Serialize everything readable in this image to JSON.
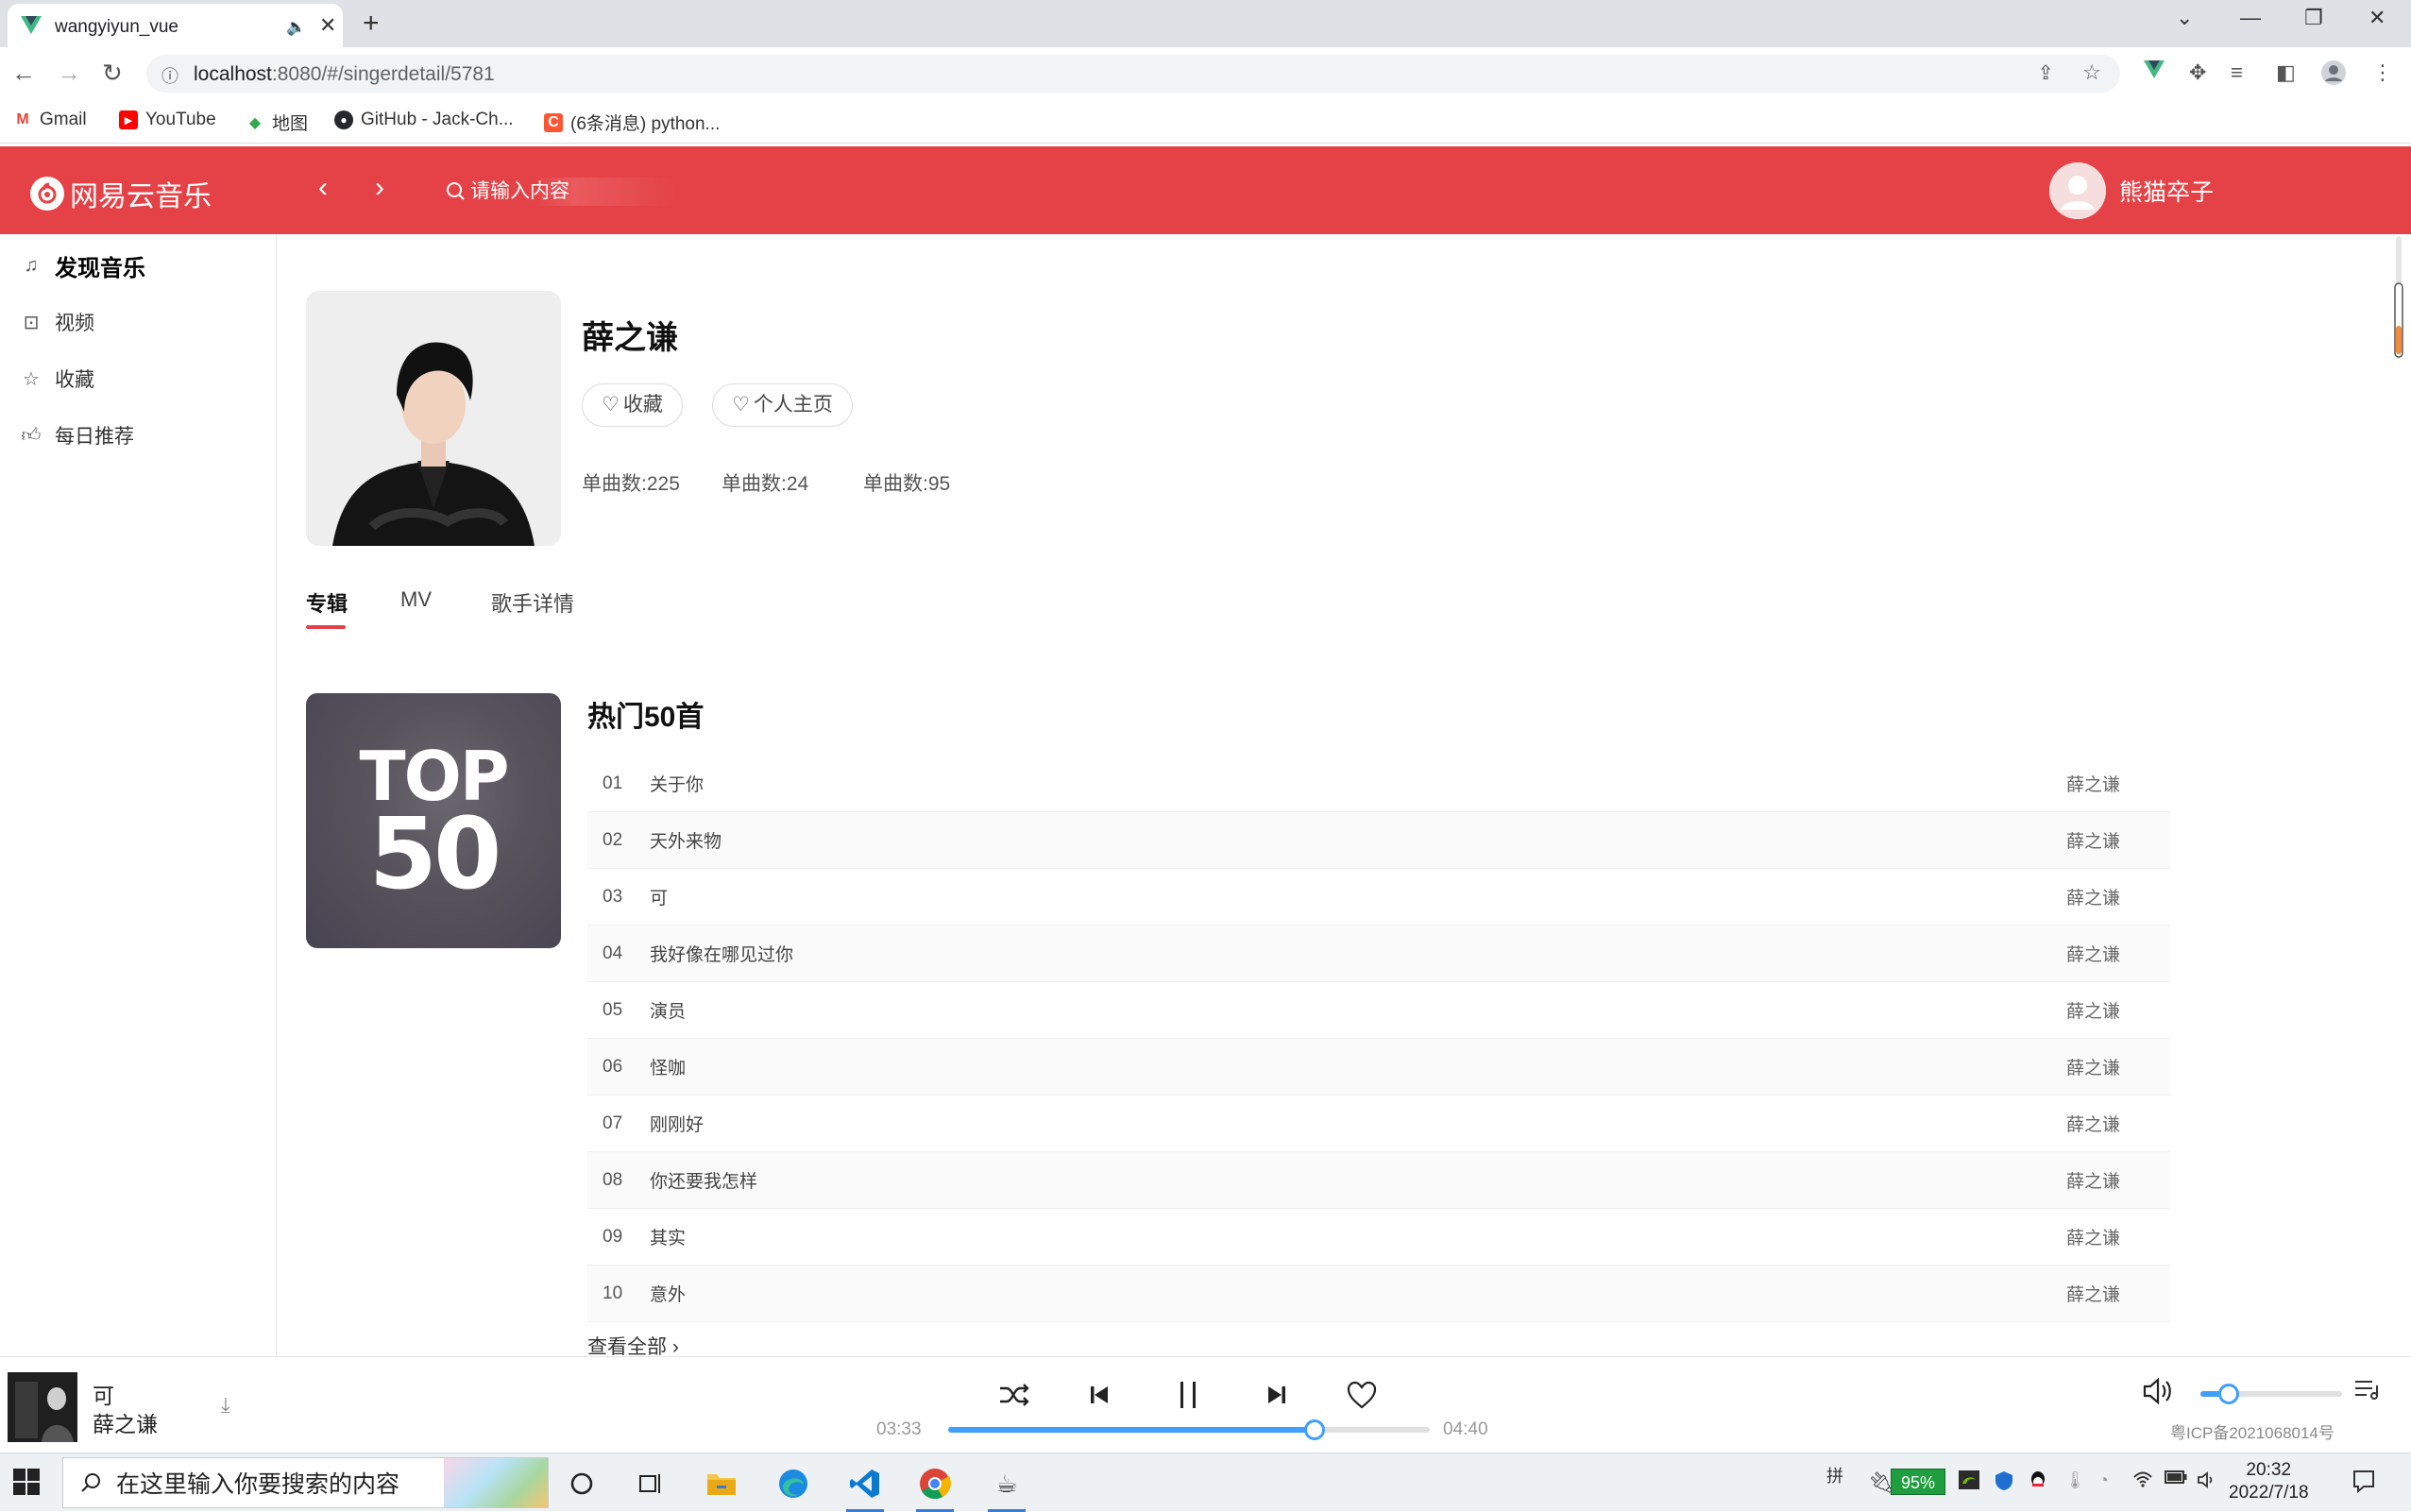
{
  "browser": {
    "tab_title": "wangyiyun_vue",
    "url_host": "localhost",
    "url_path": ":8080/#/singerdetail/5781",
    "bookmarks": [
      {
        "label": "Gmail",
        "icon": "gmail-icon",
        "color": "#ea4335"
      },
      {
        "label": "YouTube",
        "icon": "youtube-icon",
        "color": "#ff0000"
      },
      {
        "label": "地图",
        "icon": "maps-icon",
        "color": "#34a853"
      },
      {
        "label": "GitHub - Jack-Ch...",
        "icon": "github-icon",
        "color": "#24292e"
      },
      {
        "label": "(6条消息) python...",
        "icon": "csdn-icon",
        "color": "#fc5531"
      }
    ]
  },
  "app": {
    "logo_text": "网易云音乐",
    "search_placeholder": "请输入内容",
    "user_name": "熊猫卒子",
    "accent_color": "#e44246"
  },
  "sidebar": {
    "items": [
      {
        "label": "发现音乐",
        "icon": "music-note-icon"
      },
      {
        "label": "视频",
        "icon": "video-icon"
      },
      {
        "label": "收藏",
        "icon": "star-icon"
      },
      {
        "label": "每日推荐",
        "icon": "thumbs-up-icon"
      }
    ]
  },
  "singer": {
    "name": "薛之谦",
    "collect_label": "收藏",
    "homepage_label": "个人主页",
    "stats": [
      "单曲数:225",
      "单曲数:24",
      "单曲数:95"
    ]
  },
  "tabs": [
    "专辑",
    "MV",
    "歌手详情"
  ],
  "top50": {
    "title": "热门50首",
    "cover_line1": "TOP",
    "cover_line2": "50",
    "songs": [
      {
        "no": "01",
        "name": "关于你",
        "artist": "薛之谦"
      },
      {
        "no": "02",
        "name": "天外来物",
        "artist": "薛之谦"
      },
      {
        "no": "03",
        "name": "可",
        "artist": "薛之谦"
      },
      {
        "no": "04",
        "name": "我好像在哪见过你",
        "artist": "薛之谦"
      },
      {
        "no": "05",
        "name": "演员",
        "artist": "薛之谦"
      },
      {
        "no": "06",
        "name": "怪咖",
        "artist": "薛之谦"
      },
      {
        "no": "07",
        "name": "刚刚好",
        "artist": "薛之谦"
      },
      {
        "no": "08",
        "name": "你还要我怎样",
        "artist": "薛之谦"
      },
      {
        "no": "09",
        "name": "其实",
        "artist": "薛之谦"
      },
      {
        "no": "10",
        "name": "意外",
        "artist": "薛之谦"
      }
    ],
    "view_all": "查看全部"
  },
  "player": {
    "title": "可",
    "artist": "薛之谦",
    "current_time": "03:33",
    "total_time": "04:40",
    "progress": 0.76,
    "volume": 0.2,
    "icp": "粤ICP备2021068014号"
  },
  "taskbar": {
    "search_placeholder": "在这里输入你要搜索的内容",
    "ime": "拼",
    "battery": "95%",
    "time": "20:32",
    "date": "2022/7/18"
  }
}
